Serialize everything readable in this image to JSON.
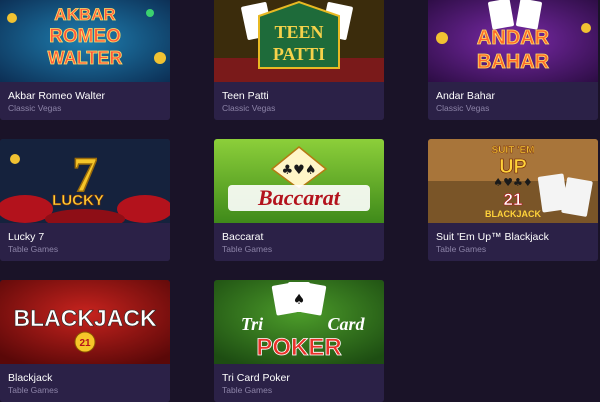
{
  "games": [
    {
      "name": "Akbar Romeo Walter",
      "category": "Classic Vegas",
      "art": [
        "AKBAR",
        "ROMEO",
        "WALTER"
      ]
    },
    {
      "name": "Teen Patti",
      "category": "Classic Vegas",
      "art": [
        "TEEN",
        "PATTI"
      ]
    },
    {
      "name": "Andar Bahar",
      "category": "Classic Vegas",
      "art": [
        "ANDAR",
        "BAHAR"
      ]
    },
    {
      "name": "Lucky 7",
      "category": "Table Games",
      "art": [
        "7",
        "LUCKY"
      ]
    },
    {
      "name": "Baccarat",
      "category": "Table Games",
      "art": [
        "Baccarat"
      ]
    },
    {
      "name": "Suit 'Em Up™ Blackjack",
      "category": "Table Games",
      "art": [
        "SUIT 'EM",
        "UP",
        "21",
        "BLACKJACK"
      ]
    },
    {
      "name": "Blackjack",
      "category": "Table Games",
      "art": [
        "BLACKJACK",
        "21"
      ]
    },
    {
      "name": "Tri Card Poker",
      "category": "Table Games",
      "art": [
        "Tri",
        "Card",
        "POKER"
      ]
    }
  ]
}
